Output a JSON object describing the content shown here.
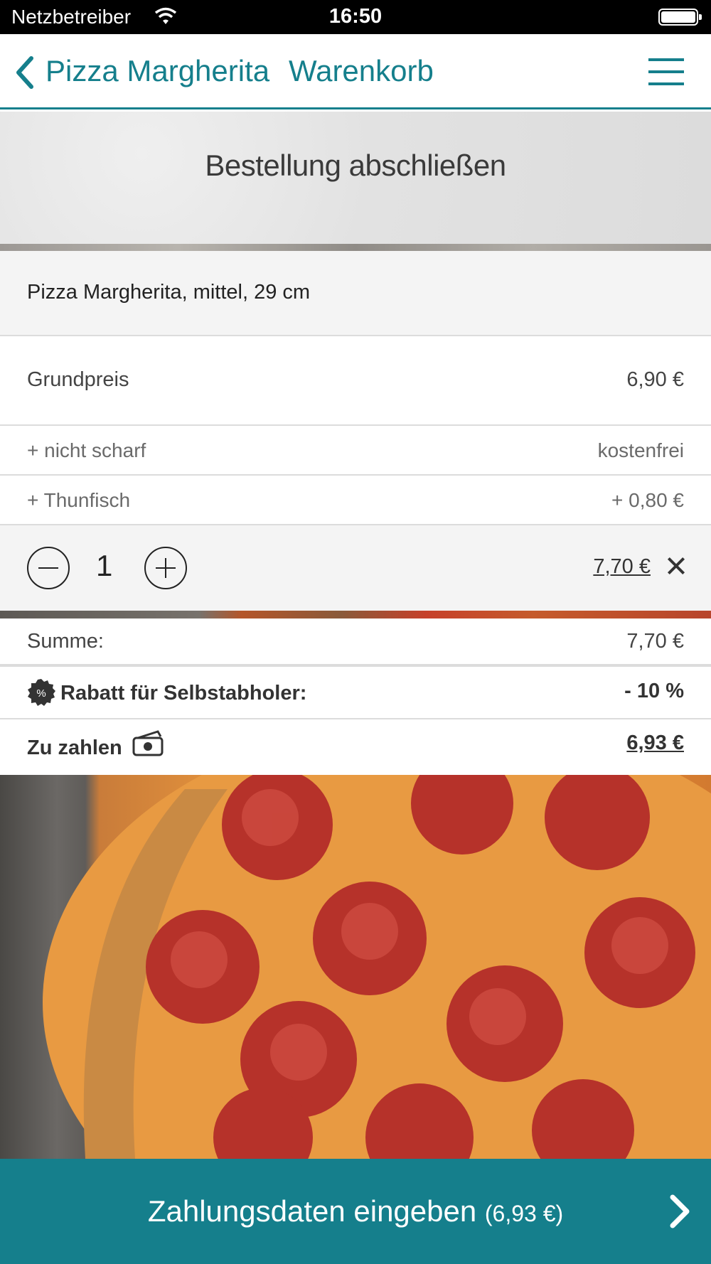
{
  "status_bar": {
    "carrier": "Netzbetreiber",
    "time": "16:50"
  },
  "nav": {
    "back_label": "Pizza Margherita",
    "title": "Warenkorb"
  },
  "header": {
    "title": "Bestellung abschließen"
  },
  "cart_item": {
    "name": "Pizza Margherita, mittel, 29 cm",
    "base_label": "Grundpreis",
    "base_price": "6,90 €",
    "options": [
      {
        "label": "+ nicht scharf",
        "price": "kostenfrei"
      },
      {
        "label": "+ Thunfisch",
        "price": "+ 0,80 €"
      }
    ],
    "quantity": "1",
    "line_total": "7,70 €"
  },
  "summary": {
    "sum_label": "Summe:",
    "sum_value": "7,70 €",
    "discount_label": "Rabatt für Selbstabholer:",
    "discount_value": "- 10 %",
    "pay_label": "Zu zahlen",
    "pay_value": "6,93 €"
  },
  "cta": {
    "label": "Zahlungsdaten eingeben",
    "amount": "(6,93 €)"
  },
  "colors": {
    "accent": "#157f8c"
  }
}
